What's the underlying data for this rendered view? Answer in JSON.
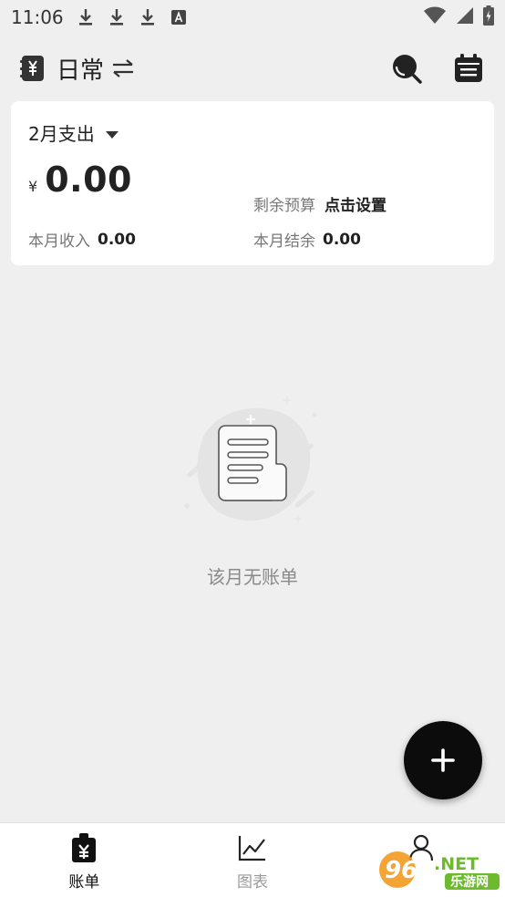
{
  "status_bar": {
    "time": "11:06",
    "icons": [
      "download-icon",
      "download-icon",
      "download-icon",
      "a-app-icon",
      "wifi-icon",
      "signal-icon",
      "battery-icon"
    ]
  },
  "app_bar": {
    "title": "日常",
    "icons": [
      "ledger-book-icon",
      "swap-icon",
      "search-icon",
      "calendar-icon"
    ]
  },
  "summary": {
    "month_label": "2月支出",
    "currency": "¥",
    "amount": "0.00",
    "budget_label": "剩余预算",
    "budget_action": "点击设置",
    "income_label": "本月收入",
    "income_value": "0.00",
    "balance_label": "本月结余",
    "balance_value": "0.00"
  },
  "empty_state": {
    "icon": "empty-receipt-icon",
    "text": "该月无账单"
  },
  "fab": {
    "icon": "plus-icon"
  },
  "bottom_nav": {
    "items": [
      {
        "label": "账单",
        "icon": "bill-icon",
        "active": true
      },
      {
        "label": "图表",
        "icon": "chart-icon",
        "active": false
      },
      {
        "label": "",
        "icon": "profile-icon",
        "active": false
      }
    ]
  },
  "watermark": {
    "text": "962.NET 乐游网"
  },
  "colors": {
    "background": "#efefef",
    "card": "#ffffff",
    "primary": "#0c0c0c",
    "muted_text": "#777777",
    "watermark_orange": "#f39a1e",
    "watermark_green": "#6dbb2d"
  }
}
